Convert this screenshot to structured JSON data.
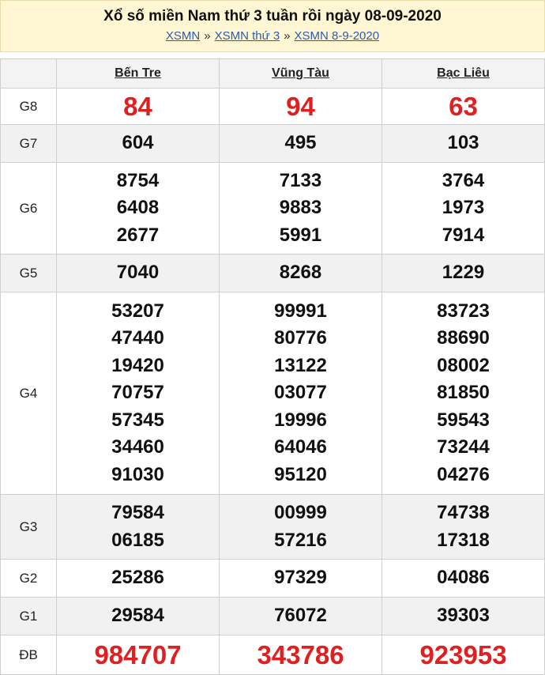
{
  "header": {
    "title": "Xổ số miền Nam thứ 3 tuần rồi ngày 08-09-2020",
    "crumb_1": "XSMN",
    "sep": "»",
    "crumb_2": "XSMN thứ 3",
    "crumb_3": "XSMN 8-9-2020"
  },
  "provinces": [
    "Bến Tre",
    "Vũng Tàu",
    "Bạc Liêu"
  ],
  "rows": [
    {
      "label": "G8",
      "values": [
        [
          "84"
        ],
        [
          "94"
        ],
        [
          "63"
        ]
      ]
    },
    {
      "label": "G7",
      "values": [
        [
          "604"
        ],
        [
          "495"
        ],
        [
          "103"
        ]
      ]
    },
    {
      "label": "G6",
      "values": [
        [
          "8754",
          "6408",
          "2677"
        ],
        [
          "7133",
          "9883",
          "5991"
        ],
        [
          "3764",
          "1973",
          "7914"
        ]
      ]
    },
    {
      "label": "G5",
      "values": [
        [
          "7040"
        ],
        [
          "8268"
        ],
        [
          "1229"
        ]
      ]
    },
    {
      "label": "G4",
      "values": [
        [
          "53207",
          "47440",
          "19420",
          "70757",
          "57345",
          "34460",
          "91030"
        ],
        [
          "99991",
          "80776",
          "13122",
          "03077",
          "19996",
          "64046",
          "95120"
        ],
        [
          "83723",
          "88690",
          "08002",
          "81850",
          "59543",
          "73244",
          "04276"
        ]
      ]
    },
    {
      "label": "G3",
      "values": [
        [
          "79584",
          "06185"
        ],
        [
          "00999",
          "57216"
        ],
        [
          "74738",
          "17318"
        ]
      ]
    },
    {
      "label": "G2",
      "values": [
        [
          "25286"
        ],
        [
          "97329"
        ],
        [
          "04086"
        ]
      ]
    },
    {
      "label": "G1",
      "values": [
        [
          "29584"
        ],
        [
          "76072"
        ],
        [
          "39303"
        ]
      ]
    },
    {
      "label": "ĐB",
      "values": [
        [
          "984707"
        ],
        [
          "343786"
        ],
        [
          "923953"
        ]
      ]
    }
  ]
}
